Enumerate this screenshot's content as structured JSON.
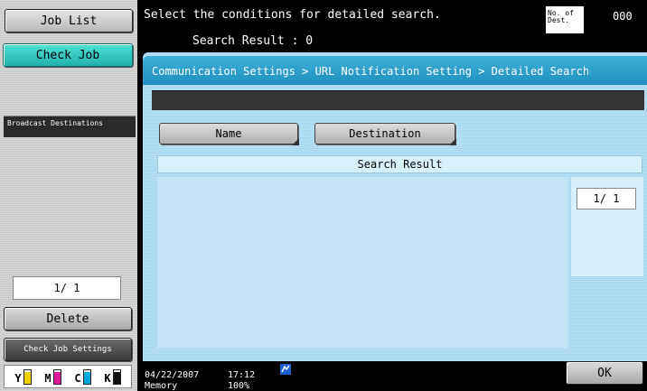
{
  "left_panel": {
    "job_list_label": "Job List",
    "check_job_label": "Check Job",
    "broadcast_label": "Broadcast Destinations",
    "page_indicator": "1/ 1",
    "delete_label": "Delete",
    "check_job_settings_label": "Check Job Settings",
    "toner": [
      {
        "label": "Y",
        "color": "#f0d000",
        "level": 0.85
      },
      {
        "label": "M",
        "color": "#e0189a",
        "level": 0.85
      },
      {
        "label": "C",
        "color": "#00a8e0",
        "level": 0.85
      },
      {
        "label": "K",
        "color": "#111111",
        "level": 0.85
      }
    ]
  },
  "header": {
    "message": "Select the conditions for detailed search.",
    "search_result_label": "Search Result  :",
    "search_result_value": "0",
    "dest_box_label": "No. of Dest.",
    "dest_count": "000"
  },
  "main": {
    "breadcrumb": "Communication Settings > URL Notification Setting > Detailed Search",
    "tabs": [
      {
        "label": "Name"
      },
      {
        "label": "Destination"
      }
    ],
    "result_header": "Search Result",
    "pager": "1/ 1"
  },
  "status_bar": {
    "date": "04/22/2007",
    "time": "17:12",
    "memory_label": "Memory",
    "memory_value": "100%",
    "ok_label": "OK"
  }
}
